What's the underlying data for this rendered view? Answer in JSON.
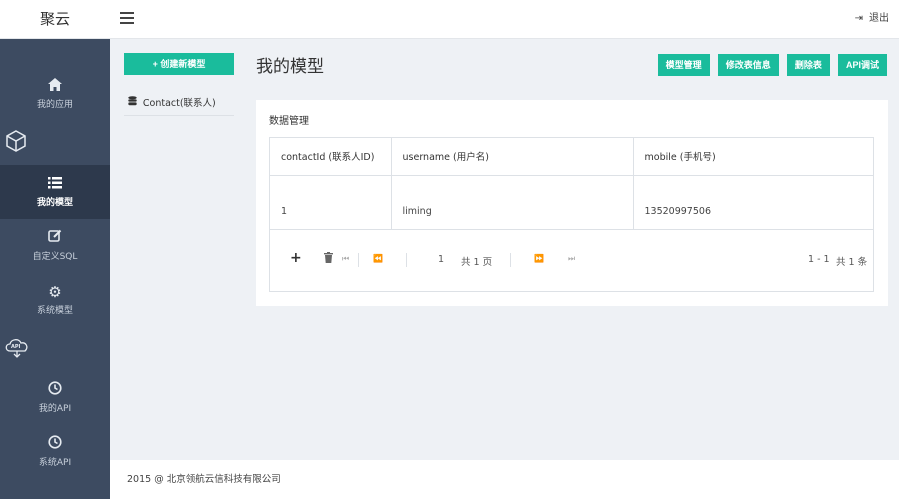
{
  "brand": "聚云",
  "header": {
    "logout_label": "退出"
  },
  "sidebar": {
    "items": [
      {
        "label": "我的应用"
      },
      {
        "label": "我的模型"
      },
      {
        "label": "自定义SQL"
      },
      {
        "label": "系统模型"
      },
      {
        "label": "我的API"
      },
      {
        "label": "系统API"
      }
    ],
    "api_logo_text": "API"
  },
  "left": {
    "create_label": "+ 创建新模型",
    "models": [
      {
        "label": "Contact(联系人)"
      }
    ]
  },
  "main": {
    "title": "我的模型",
    "actions": [
      "模型管理",
      "修改表信息",
      "删除表",
      "API调试"
    ]
  },
  "panel": {
    "title": "数据管理",
    "columns": [
      "contactId (联系人ID)",
      "username (用户名)",
      "mobile (手机号)"
    ],
    "rows": [
      [
        "1",
        "liming",
        "13520997506"
      ]
    ],
    "pager": {
      "page": "1",
      "total_pages": "共 1 页",
      "range": "1 - 1",
      "total_records": "共 1 条"
    }
  },
  "footer": {
    "text": "2015 @ 北京领航云信科技有限公司"
  }
}
